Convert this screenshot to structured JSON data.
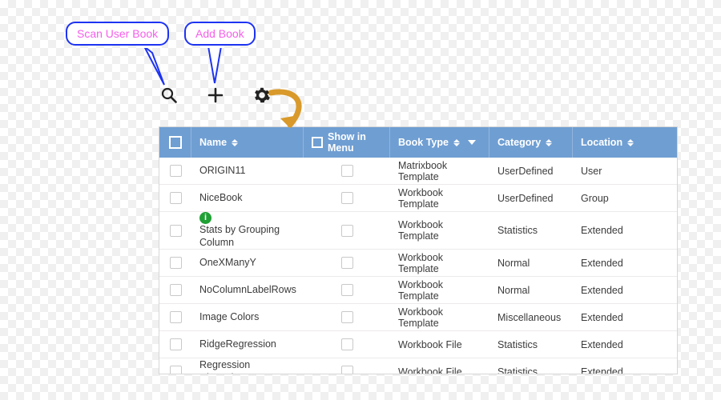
{
  "callouts": {
    "scan": "Scan User Book",
    "add": "Add Book"
  },
  "toolbar": {
    "search_icon": "search",
    "add_icon": "add",
    "gear_icon": "settings"
  },
  "columns": {
    "name": "Name",
    "show_in_menu": "Show in Menu",
    "book_type": "Book Type",
    "category": "Category",
    "location": "Location"
  },
  "rows": [
    {
      "info": false,
      "name": "ORIGIN11",
      "show": false,
      "type": "Matrixbook Template",
      "category": "UserDefined",
      "location": "User"
    },
    {
      "info": false,
      "name": "NiceBook",
      "show": false,
      "type": "Workbook Template",
      "category": "UserDefined",
      "location": "Group"
    },
    {
      "info": true,
      "name": "Stats by Grouping Column",
      "show": false,
      "type": "Workbook Template",
      "category": "Statistics",
      "location": "Extended"
    },
    {
      "info": false,
      "name": "OneXManyY",
      "show": false,
      "type": "Workbook Template",
      "category": "Normal",
      "location": "Extended"
    },
    {
      "info": false,
      "name": "NoColumnLabelRows",
      "show": false,
      "type": "Workbook Template",
      "category": "Normal",
      "location": "Extended"
    },
    {
      "info": false,
      "name": "Image Colors",
      "show": false,
      "type": "Workbook Template",
      "category": "Miscellaneous",
      "location": "Extended"
    },
    {
      "info": false,
      "name": "RidgeRegression",
      "show": false,
      "type": "Workbook File",
      "category": "Statistics",
      "location": "Extended"
    },
    {
      "info": false,
      "name": "Regression Clustering",
      "show": false,
      "type": "Workbook File",
      "category": "Statistics",
      "location": "Extended"
    }
  ]
}
